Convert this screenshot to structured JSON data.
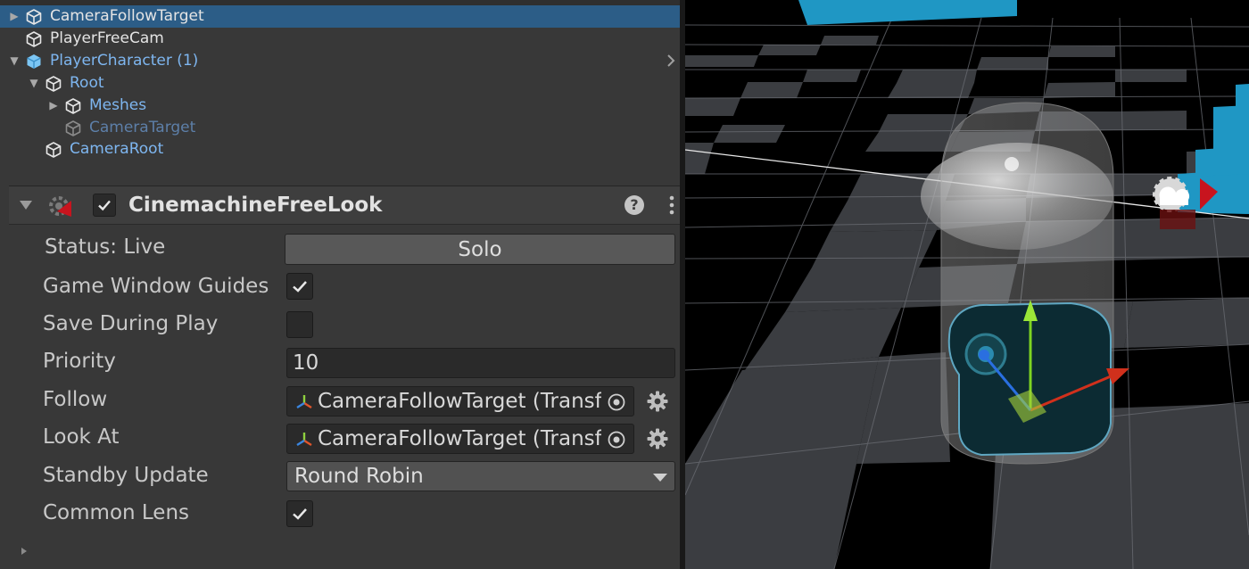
{
  "hierarchy": {
    "items": [
      {
        "label": "CameraFollowTarget",
        "selected": true,
        "arrow": "collapsed",
        "icon": "gameobject-icon",
        "style": "white"
      },
      {
        "label": "PlayerFreeCam",
        "selected": false,
        "arrow": "none",
        "icon": "gameobject-icon",
        "style": "white"
      },
      {
        "label": "PlayerCharacter (1)",
        "selected": false,
        "arrow": "expanded",
        "icon": "prefab-icon",
        "style": "blue"
      },
      {
        "label": "Root",
        "selected": false,
        "arrow": "expanded",
        "icon": "gameobject-icon",
        "style": "blue"
      },
      {
        "label": "Meshes",
        "selected": false,
        "arrow": "collapsed",
        "icon": "gameobject-icon",
        "style": "blue"
      },
      {
        "label": "CameraTarget",
        "selected": false,
        "arrow": "none",
        "icon": "gameobject-icon",
        "style": "dim"
      },
      {
        "label": "CameraRoot",
        "selected": false,
        "arrow": "none",
        "icon": "gameobject-icon",
        "style": "blue"
      }
    ]
  },
  "component": {
    "title": "CinemachineFreeLook",
    "enabled": true,
    "help_icon": "?",
    "icons": {
      "component": "cinemachine-camera-icon",
      "help": "help-icon",
      "menu": "kebab-menu-icon"
    }
  },
  "fields": {
    "status_label": "Status: Live",
    "solo_button": "Solo",
    "game_window_guides": {
      "label": "Game Window Guides",
      "checked": true
    },
    "save_during_play": {
      "label": "Save During Play",
      "checked": false
    },
    "priority": {
      "label": "Priority",
      "value": "10"
    },
    "follow": {
      "label": "Follow",
      "value": "CameraFollowTarget (Transform)"
    },
    "look_at": {
      "label": "Look At",
      "value": "CameraFollowTarget (Transform)"
    },
    "standby_update": {
      "label": "Standby Update",
      "value": "Round Robin"
    },
    "common_lens": {
      "label": "Common Lens",
      "checked": true
    }
  },
  "scene": {
    "colors": {
      "floor_dark": "#000000",
      "floor_light": "#3b3d41",
      "grid_line": "#6b6e74",
      "cube": "#1f97c4",
      "gizmo_y": "#7ed321",
      "gizmo_x": "#d0301c",
      "gizmo_z": "#2a6fe0"
    }
  }
}
